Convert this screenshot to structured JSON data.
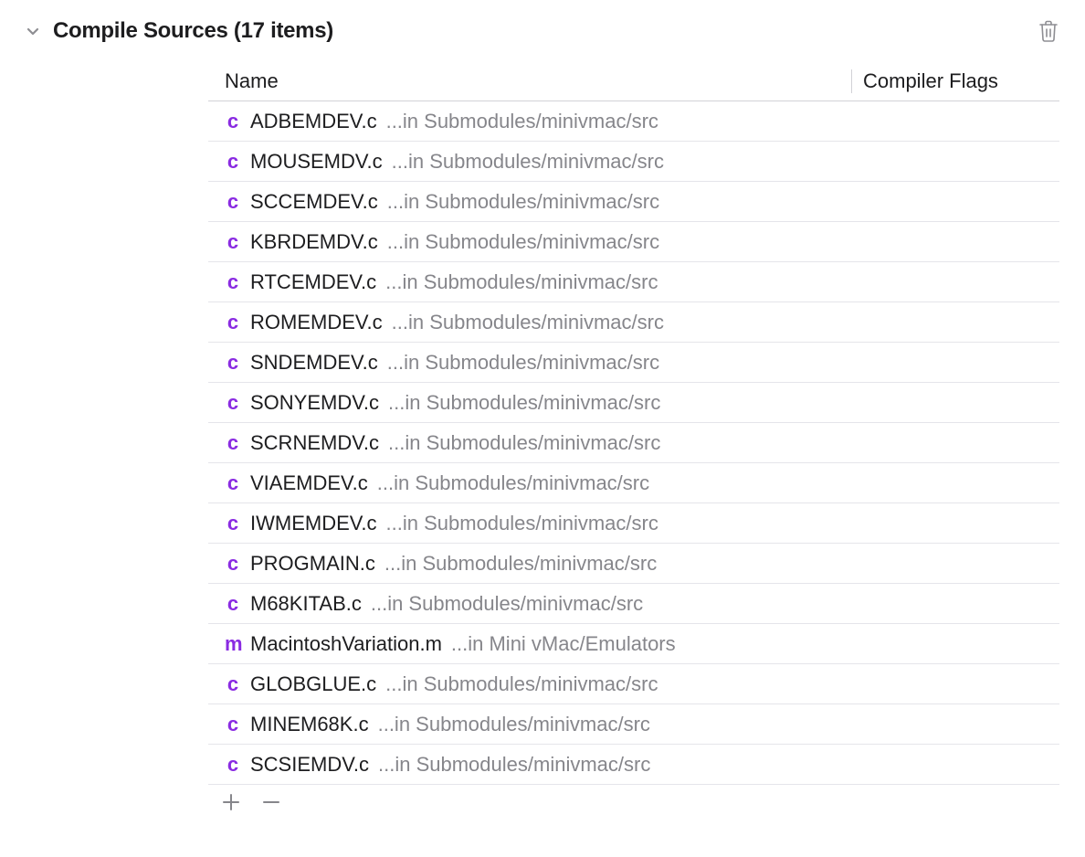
{
  "section": {
    "title": "Compile Sources (17 items)"
  },
  "columns": {
    "name": "Name",
    "flags": "Compiler Flags"
  },
  "rows": [
    {
      "icon": "c",
      "name": "ADBEMDEV.c",
      "path": "...in Submodules/minivmac/src",
      "flags": ""
    },
    {
      "icon": "c",
      "name": "MOUSEMDV.c",
      "path": "...in Submodules/minivmac/src",
      "flags": ""
    },
    {
      "icon": "c",
      "name": "SCCEMDEV.c",
      "path": "...in Submodules/minivmac/src",
      "flags": ""
    },
    {
      "icon": "c",
      "name": "KBRDEMDV.c",
      "path": "...in Submodules/minivmac/src",
      "flags": ""
    },
    {
      "icon": "c",
      "name": "RTCEMDEV.c",
      "path": "...in Submodules/minivmac/src",
      "flags": ""
    },
    {
      "icon": "c",
      "name": "ROMEMDEV.c",
      "path": "...in Submodules/minivmac/src",
      "flags": ""
    },
    {
      "icon": "c",
      "name": "SNDEMDEV.c",
      "path": "...in Submodules/minivmac/src",
      "flags": ""
    },
    {
      "icon": "c",
      "name": "SONYEMDV.c",
      "path": "...in Submodules/minivmac/src",
      "flags": ""
    },
    {
      "icon": "c",
      "name": "SCRNEMDV.c",
      "path": "...in Submodules/minivmac/src",
      "flags": ""
    },
    {
      "icon": "c",
      "name": "VIAEMDEV.c",
      "path": "...in Submodules/minivmac/src",
      "flags": ""
    },
    {
      "icon": "c",
      "name": "IWMEMDEV.c",
      "path": "...in Submodules/minivmac/src",
      "flags": ""
    },
    {
      "icon": "c",
      "name": "PROGMAIN.c",
      "path": "...in Submodules/minivmac/src",
      "flags": ""
    },
    {
      "icon": "c",
      "name": "M68KITAB.c",
      "path": "...in Submodules/minivmac/src",
      "flags": ""
    },
    {
      "icon": "m",
      "name": "MacintoshVariation.m",
      "path": "...in Mini vMac/Emulators",
      "flags": ""
    },
    {
      "icon": "c",
      "name": "GLOBGLUE.c",
      "path": "...in Submodules/minivmac/src",
      "flags": ""
    },
    {
      "icon": "c",
      "name": "MINEM68K.c",
      "path": "...in Submodules/minivmac/src",
      "flags": ""
    },
    {
      "icon": "c",
      "name": "SCSIEMDV.c",
      "path": "...in Submodules/minivmac/src",
      "flags": ""
    }
  ]
}
